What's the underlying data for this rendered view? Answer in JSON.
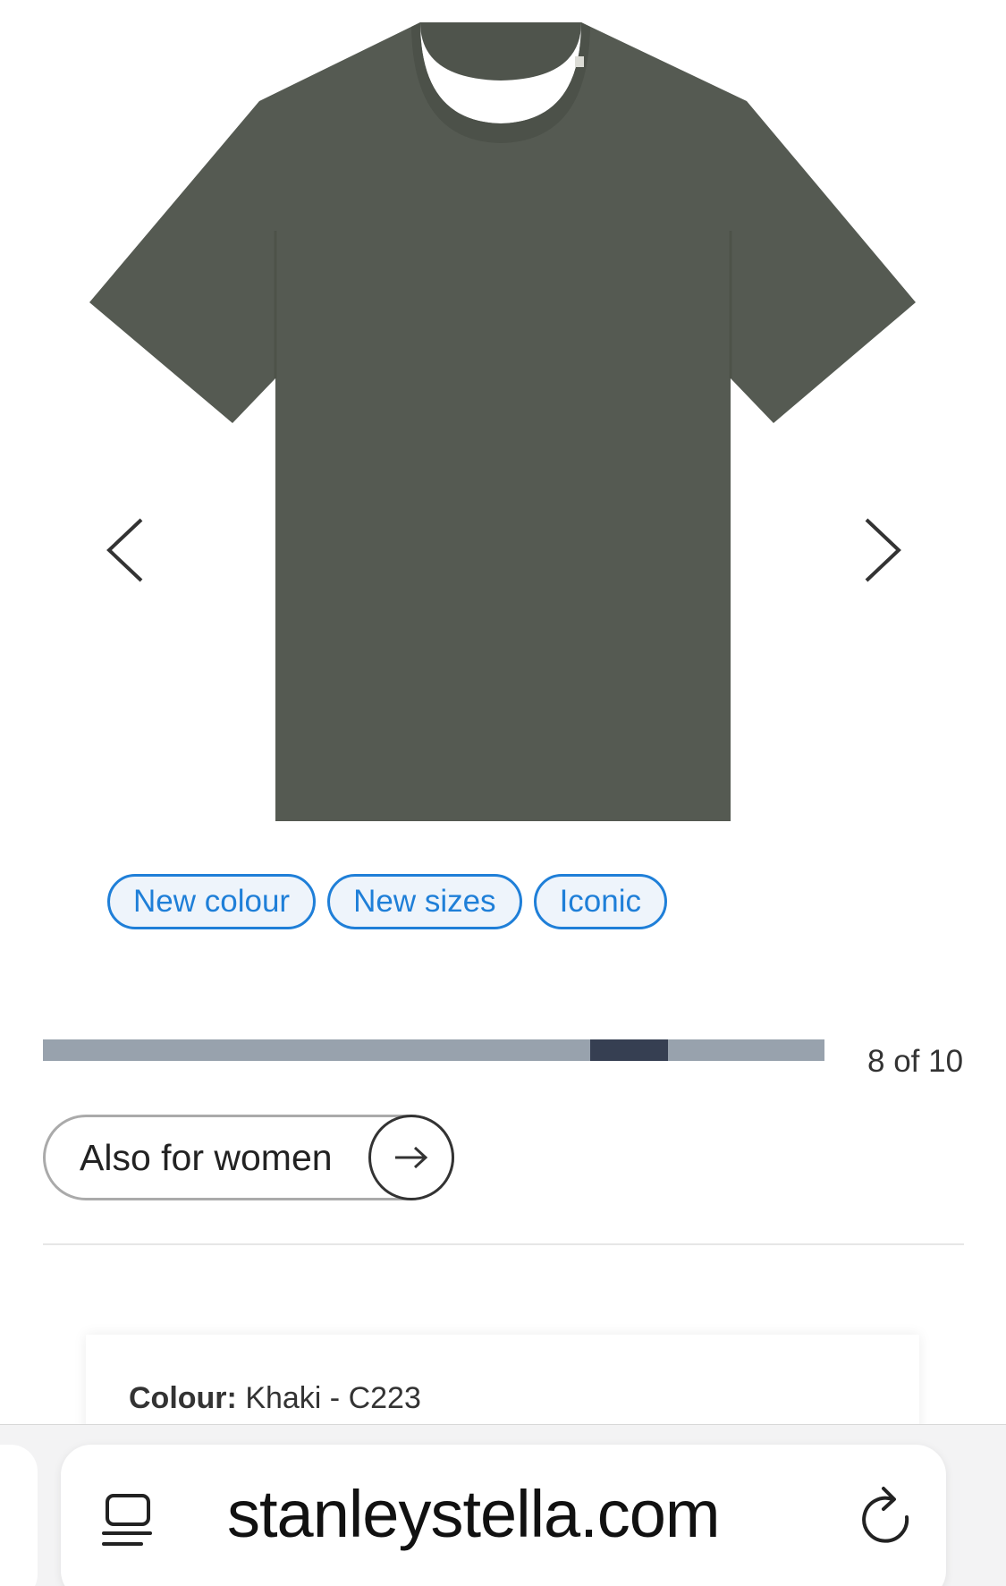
{
  "gallery": {
    "image_alt": "Khaki t-shirt",
    "prev_icon": "chevron-left-icon",
    "next_icon": "chevron-right-icon"
  },
  "badges": [
    {
      "label": "New colour"
    },
    {
      "label": "New sizes"
    },
    {
      "label": "Iconic"
    }
  ],
  "carousel": {
    "current": 8,
    "total": 10,
    "counter_text": "8 of 10"
  },
  "also_for_women": {
    "label": "Also for women",
    "icon": "arrow-right-icon"
  },
  "product": {
    "colour_label": "Colour:",
    "colour_value": "Khaki - C223"
  },
  "browser": {
    "url": "stanleystella.com",
    "reader_icon": "reader-mode-icon",
    "reload_icon": "reload-icon"
  },
  "colors": {
    "shirt": "#555a52",
    "badge_accent": "#1f7fd8",
    "progress_track": "#98a2ad",
    "progress_active": "#363f52"
  }
}
